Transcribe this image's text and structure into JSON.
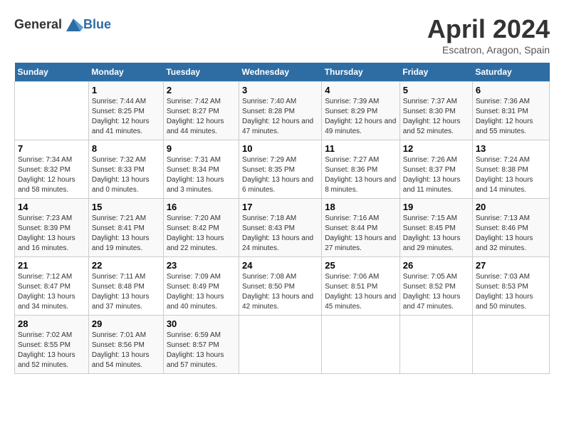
{
  "logo": {
    "general": "General",
    "blue": "Blue"
  },
  "title": "April 2024",
  "subtitle": "Escatron, Aragon, Spain",
  "headers": [
    "Sunday",
    "Monday",
    "Tuesday",
    "Wednesday",
    "Thursday",
    "Friday",
    "Saturday"
  ],
  "weeks": [
    [
      {
        "day": "",
        "sunrise": "",
        "sunset": "",
        "daylight": ""
      },
      {
        "day": "1",
        "sunrise": "Sunrise: 7:44 AM",
        "sunset": "Sunset: 8:25 PM",
        "daylight": "Daylight: 12 hours and 41 minutes."
      },
      {
        "day": "2",
        "sunrise": "Sunrise: 7:42 AM",
        "sunset": "Sunset: 8:27 PM",
        "daylight": "Daylight: 12 hours and 44 minutes."
      },
      {
        "day": "3",
        "sunrise": "Sunrise: 7:40 AM",
        "sunset": "Sunset: 8:28 PM",
        "daylight": "Daylight: 12 hours and 47 minutes."
      },
      {
        "day": "4",
        "sunrise": "Sunrise: 7:39 AM",
        "sunset": "Sunset: 8:29 PM",
        "daylight": "Daylight: 12 hours and 49 minutes."
      },
      {
        "day": "5",
        "sunrise": "Sunrise: 7:37 AM",
        "sunset": "Sunset: 8:30 PM",
        "daylight": "Daylight: 12 hours and 52 minutes."
      },
      {
        "day": "6",
        "sunrise": "Sunrise: 7:36 AM",
        "sunset": "Sunset: 8:31 PM",
        "daylight": "Daylight: 12 hours and 55 minutes."
      }
    ],
    [
      {
        "day": "7",
        "sunrise": "Sunrise: 7:34 AM",
        "sunset": "Sunset: 8:32 PM",
        "daylight": "Daylight: 12 hours and 58 minutes."
      },
      {
        "day": "8",
        "sunrise": "Sunrise: 7:32 AM",
        "sunset": "Sunset: 8:33 PM",
        "daylight": "Daylight: 13 hours and 0 minutes."
      },
      {
        "day": "9",
        "sunrise": "Sunrise: 7:31 AM",
        "sunset": "Sunset: 8:34 PM",
        "daylight": "Daylight: 13 hours and 3 minutes."
      },
      {
        "day": "10",
        "sunrise": "Sunrise: 7:29 AM",
        "sunset": "Sunset: 8:35 PM",
        "daylight": "Daylight: 13 hours and 6 minutes."
      },
      {
        "day": "11",
        "sunrise": "Sunrise: 7:27 AM",
        "sunset": "Sunset: 8:36 PM",
        "daylight": "Daylight: 13 hours and 8 minutes."
      },
      {
        "day": "12",
        "sunrise": "Sunrise: 7:26 AM",
        "sunset": "Sunset: 8:37 PM",
        "daylight": "Daylight: 13 hours and 11 minutes."
      },
      {
        "day": "13",
        "sunrise": "Sunrise: 7:24 AM",
        "sunset": "Sunset: 8:38 PM",
        "daylight": "Daylight: 13 hours and 14 minutes."
      }
    ],
    [
      {
        "day": "14",
        "sunrise": "Sunrise: 7:23 AM",
        "sunset": "Sunset: 8:39 PM",
        "daylight": "Daylight: 13 hours and 16 minutes."
      },
      {
        "day": "15",
        "sunrise": "Sunrise: 7:21 AM",
        "sunset": "Sunset: 8:41 PM",
        "daylight": "Daylight: 13 hours and 19 minutes."
      },
      {
        "day": "16",
        "sunrise": "Sunrise: 7:20 AM",
        "sunset": "Sunset: 8:42 PM",
        "daylight": "Daylight: 13 hours and 22 minutes."
      },
      {
        "day": "17",
        "sunrise": "Sunrise: 7:18 AM",
        "sunset": "Sunset: 8:43 PM",
        "daylight": "Daylight: 13 hours and 24 minutes."
      },
      {
        "day": "18",
        "sunrise": "Sunrise: 7:16 AM",
        "sunset": "Sunset: 8:44 PM",
        "daylight": "Daylight: 13 hours and 27 minutes."
      },
      {
        "day": "19",
        "sunrise": "Sunrise: 7:15 AM",
        "sunset": "Sunset: 8:45 PM",
        "daylight": "Daylight: 13 hours and 29 minutes."
      },
      {
        "day": "20",
        "sunrise": "Sunrise: 7:13 AM",
        "sunset": "Sunset: 8:46 PM",
        "daylight": "Daylight: 13 hours and 32 minutes."
      }
    ],
    [
      {
        "day": "21",
        "sunrise": "Sunrise: 7:12 AM",
        "sunset": "Sunset: 8:47 PM",
        "daylight": "Daylight: 13 hours and 34 minutes."
      },
      {
        "day": "22",
        "sunrise": "Sunrise: 7:11 AM",
        "sunset": "Sunset: 8:48 PM",
        "daylight": "Daylight: 13 hours and 37 minutes."
      },
      {
        "day": "23",
        "sunrise": "Sunrise: 7:09 AM",
        "sunset": "Sunset: 8:49 PM",
        "daylight": "Daylight: 13 hours and 40 minutes."
      },
      {
        "day": "24",
        "sunrise": "Sunrise: 7:08 AM",
        "sunset": "Sunset: 8:50 PM",
        "daylight": "Daylight: 13 hours and 42 minutes."
      },
      {
        "day": "25",
        "sunrise": "Sunrise: 7:06 AM",
        "sunset": "Sunset: 8:51 PM",
        "daylight": "Daylight: 13 hours and 45 minutes."
      },
      {
        "day": "26",
        "sunrise": "Sunrise: 7:05 AM",
        "sunset": "Sunset: 8:52 PM",
        "daylight": "Daylight: 13 hours and 47 minutes."
      },
      {
        "day": "27",
        "sunrise": "Sunrise: 7:03 AM",
        "sunset": "Sunset: 8:53 PM",
        "daylight": "Daylight: 13 hours and 50 minutes."
      }
    ],
    [
      {
        "day": "28",
        "sunrise": "Sunrise: 7:02 AM",
        "sunset": "Sunset: 8:55 PM",
        "daylight": "Daylight: 13 hours and 52 minutes."
      },
      {
        "day": "29",
        "sunrise": "Sunrise: 7:01 AM",
        "sunset": "Sunset: 8:56 PM",
        "daylight": "Daylight: 13 hours and 54 minutes."
      },
      {
        "day": "30",
        "sunrise": "Sunrise: 6:59 AM",
        "sunset": "Sunset: 8:57 PM",
        "daylight": "Daylight: 13 hours and 57 minutes."
      },
      {
        "day": "",
        "sunrise": "",
        "sunset": "",
        "daylight": ""
      },
      {
        "day": "",
        "sunrise": "",
        "sunset": "",
        "daylight": ""
      },
      {
        "day": "",
        "sunrise": "",
        "sunset": "",
        "daylight": ""
      },
      {
        "day": "",
        "sunrise": "",
        "sunset": "",
        "daylight": ""
      }
    ]
  ]
}
